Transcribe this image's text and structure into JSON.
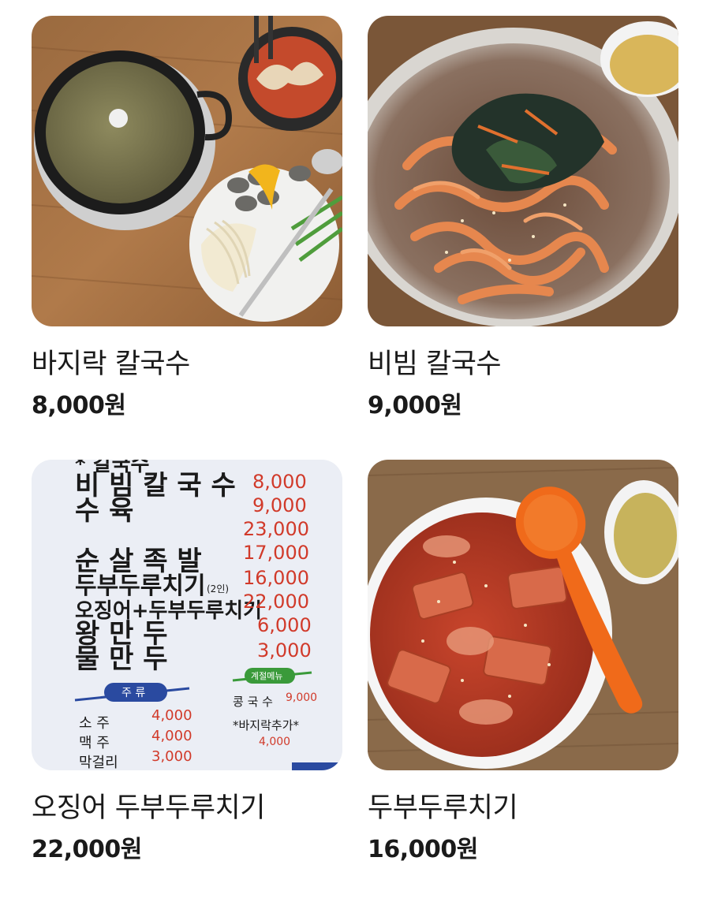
{
  "menu_items": [
    {
      "name": "바지락 칼국수",
      "price": "8,000원",
      "image": "clam-kalguksu-photo"
    },
    {
      "name": "비빔 칼국수",
      "price": "9,000원",
      "image": "bibim-kalguksu-photo"
    },
    {
      "name": "오징어 두부두루치기",
      "price": "22,000원",
      "image": "menu-board-photo"
    },
    {
      "name": "두부두루치기",
      "price": "16,000원",
      "image": "tofu-duruchigi-photo"
    }
  ],
  "menu_board": {
    "rows": [
      {
        "label": "비 빔 칼 국 수",
        "price": "8,000"
      },
      {
        "label": "수          육",
        "price": "9,000"
      },
      {
        "label": "",
        "price": "23,000"
      },
      {
        "label": "순 살 족 발",
        "price": "17,000"
      },
      {
        "label": "두부두루치기",
        "note": "(2인)",
        "price": "16,000"
      },
      {
        "label": "오징어+두부두루치기",
        "price": "22,000"
      },
      {
        "label": "왕    만    두",
        "price": "6,000"
      },
      {
        "label": "물    만    두",
        "price": "3,000"
      }
    ],
    "drinks_header": "주 류",
    "drinks": [
      {
        "label": "소    주",
        "price": "4,000"
      },
      {
        "label": "맥    주",
        "price": "4,000"
      },
      {
        "label": "막걸리",
        "price": "3,000"
      }
    ],
    "seasonal_header": "계절메뉴",
    "seasonal": [
      {
        "label": "콩 국 수",
        "price": "9,000"
      },
      {
        "label": "*바지락추가*",
        "price": "4,000"
      }
    ]
  }
}
